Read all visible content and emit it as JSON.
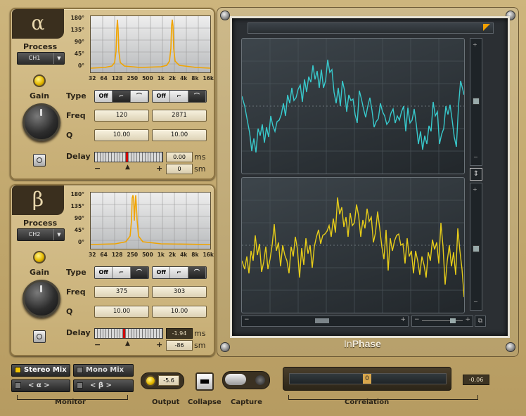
{
  "app": {
    "title_in": "In",
    "title_phase": "Phase"
  },
  "alpha": {
    "symbol": "α",
    "process_label": "Process",
    "process_value": "CH1",
    "gain_label": "Gain",
    "graph_y_ticks": [
      "180°",
      "135°",
      "90°",
      "45°",
      "0°"
    ],
    "graph_x_ticks": [
      "32",
      "64",
      "128",
      "250",
      "500",
      "1k",
      "2k",
      "4k",
      "8k",
      "16k"
    ],
    "type_label": "Type",
    "freq_label": "Freq",
    "q_label": "Q",
    "delay_label": "Delay",
    "type_options": [
      "Off",
      "",
      ""
    ],
    "freq": [
      "120",
      "2871"
    ],
    "q": [
      "10.00",
      "10.00"
    ],
    "delay_ms": "0.00",
    "delay_samples": "0",
    "unit_ms": "ms",
    "unit_sm": "sm",
    "minus": "−",
    "plus": "+"
  },
  "beta": {
    "symbol": "β",
    "process_label": "Process",
    "process_value": "CH2",
    "gain_label": "Gain",
    "graph_y_ticks": [
      "180°",
      "135°",
      "90°",
      "45°",
      "0°"
    ],
    "graph_x_ticks": [
      "32",
      "64",
      "128",
      "250",
      "500",
      "1k",
      "2k",
      "4k",
      "8k",
      "16k"
    ],
    "type_label": "Type",
    "freq_label": "Freq",
    "q_label": "Q",
    "delay_label": "Delay",
    "type_options": [
      "Off",
      "",
      ""
    ],
    "freq": [
      "375",
      "303"
    ],
    "q": [
      "10.00",
      "10.00"
    ],
    "delay_ms": "-1.94",
    "delay_samples": "-86",
    "unit_ms": "ms",
    "unit_sm": "sm",
    "minus": "−",
    "plus": "+"
  },
  "scope": {
    "minus": "−",
    "plus": "+",
    "trace_colors": {
      "top": "#38c9cc",
      "bottom": "#e6cc19"
    }
  },
  "footer": {
    "stereo_mix": "Stereo Mix",
    "mono_mix": "Mono Mix",
    "alpha_btn": "< α >",
    "beta_btn": "< β >",
    "monitor_label": "Monitor",
    "output_value": "-5.6",
    "output_label": "Output",
    "collapse_label": "Collapse",
    "capture_label": "Capture",
    "correlation_label": "Correlation",
    "correlation_value": "-0.06",
    "correlation_marker": "0"
  },
  "colors": {
    "accent": "#f0b400",
    "cyan_trace": "#38c9cc",
    "yellow_trace": "#e6cc19"
  }
}
